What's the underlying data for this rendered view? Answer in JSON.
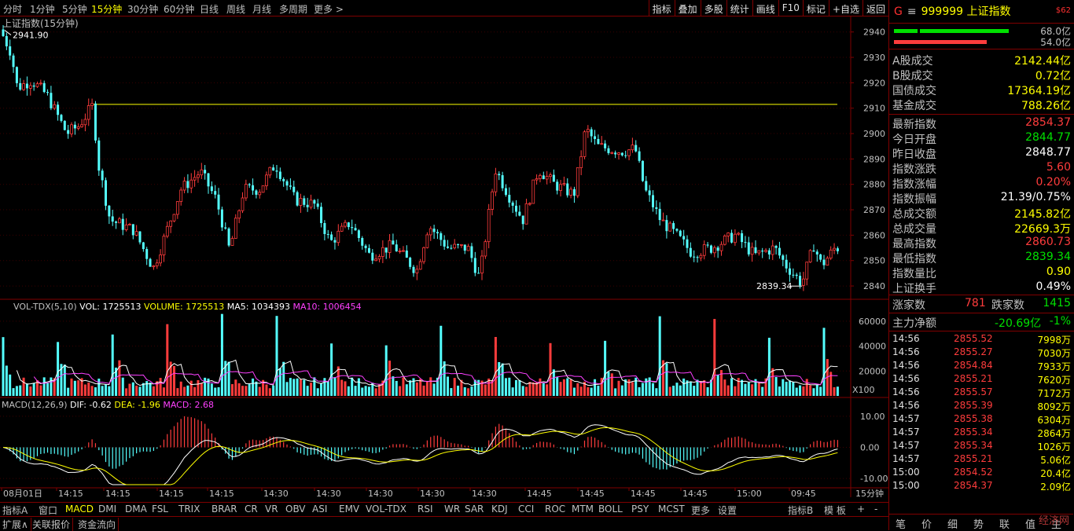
{
  "topbar": {
    "timeframes": [
      "分时",
      "1分钟",
      "5分钟",
      "15分钟",
      "30分钟",
      "60分钟",
      "日线",
      "周线",
      "月线",
      "多周期",
      "更多 >"
    ],
    "active_timeframe": "15分钟",
    "tools": [
      "指标",
      "叠加",
      "多股",
      "统计",
      "画线",
      "F10",
      "标记",
      "+自选",
      "返回"
    ]
  },
  "chart": {
    "title": "上证指数(15分钟)",
    "price_axis_ticks": [
      "2940",
      "2930",
      "2920",
      "2910",
      "2900",
      "2890",
      "2880",
      "2870",
      "2860",
      "2850",
      "2840"
    ],
    "max_label": "2941.90",
    "min_label": "2839.34",
    "vol_legend": {
      "name": "VOL-TDX(5,10)",
      "vol": "VOL: 1725513",
      "volume": "VOLUME: 1725513",
      "ma5": "MA5: 1034393",
      "ma10": "MA10: 1006454"
    },
    "vol_axis_ticks": [
      "60000",
      "40000",
      "20000"
    ],
    "vol_unit": "X100",
    "macd_legend": {
      "name": "MACD(12,26,9)",
      "dif": "DIF: -0.62",
      "dea": "DEA: -1.96",
      "macd": "MACD: 2.68"
    },
    "macd_axis_ticks": [
      "10.00",
      "0.00",
      "-10.00"
    ],
    "time_labels": [
      "08月01日",
      "14:15",
      "14:15",
      "14:15",
      "14:15",
      "14:30",
      "14:30",
      "14:30",
      "14:30",
      "14:30",
      "14:45",
      "14:45",
      "14:45",
      "14:45",
      "15:00",
      "09:45"
    ],
    "period_label": "15分钟"
  },
  "chart_data": {
    "type": "candlestick",
    "ylim": [
      2836,
      2943
    ],
    "y_ticks": [
      2840,
      2850,
      2860,
      2870,
      2880,
      2890,
      2900,
      2910,
      2920,
      2930,
      2940
    ],
    "high": 2941.9,
    "low": 2839.34,
    "reference_line": 2911.5,
    "vol_ylim": [
      0,
      70000
    ],
    "macd_ylim": [
      -12,
      14
    ]
  },
  "panel": {
    "code": "999999",
    "name": "上证指数",
    "g_label": "G",
    "eq_label": "≡",
    "badge": "$62",
    "bar1_value": "68.0亿",
    "bar2_value": "54.0亿",
    "turnover": [
      {
        "label": "A股成交",
        "value": "2142.44亿"
      },
      {
        "label": "B股成交",
        "value": "0.72亿"
      },
      {
        "label": "国债成交",
        "value": "17364.19亿"
      },
      {
        "label": "基金成交",
        "value": "788.26亿"
      }
    ],
    "stats": [
      {
        "label": "最新指数",
        "value": "2854.37",
        "color": "red"
      },
      {
        "label": "今日开盘",
        "value": "2844.77",
        "color": "green"
      },
      {
        "label": "昨日收盘",
        "value": "2848.77",
        "color": "white"
      },
      {
        "label": "指数涨跌",
        "value": "5.60",
        "color": "red"
      },
      {
        "label": "指数涨幅",
        "value": "0.20%",
        "color": "red"
      },
      {
        "label": "指数振幅",
        "value": "21.39/0.75%",
        "color": "white"
      },
      {
        "label": "总成交额",
        "value": "2145.82亿",
        "color": "yellow"
      },
      {
        "label": "总成交量",
        "value": "22669.3万",
        "color": "yellow"
      },
      {
        "label": "最高指数",
        "value": "2860.73",
        "color": "red"
      },
      {
        "label": "最低指数",
        "value": "2839.34",
        "color": "green"
      },
      {
        "label": "指数量比",
        "value": "0.90",
        "color": "yellow"
      },
      {
        "label": "上证换手",
        "value": "0.49%",
        "color": "white"
      }
    ],
    "up_label": "涨家数",
    "up_value": "781",
    "down_label": "跌家数",
    "down_value": "1415",
    "main_flow_label": "主力净额",
    "main_flow_value": "-20.69亿",
    "main_flow_pct": "-1%",
    "ticks": [
      {
        "time": "14:56",
        "price": "2855.52",
        "vol": "7998万"
      },
      {
        "time": "14:56",
        "price": "2855.27",
        "vol": "7030万"
      },
      {
        "time": "14:56",
        "price": "2854.84",
        "vol": "7933万"
      },
      {
        "time": "14:56",
        "price": "2855.21",
        "vol": "7620万"
      },
      {
        "time": "14:56",
        "price": "2855.57",
        "vol": "7172万"
      },
      {
        "time": "14:56",
        "price": "2855.39",
        "vol": "8092万"
      },
      {
        "time": "14:57",
        "price": "2855.38",
        "vol": "6304万"
      },
      {
        "time": "14:57",
        "price": "2855.34",
        "vol": "2864万"
      },
      {
        "time": "14:57",
        "price": "2855.34",
        "vol": "1026万"
      },
      {
        "time": "14:57",
        "price": "2855.21",
        "vol": "5.06亿"
      },
      {
        "time": "15:00",
        "price": "2854.52",
        "vol": "20.4亿"
      },
      {
        "time": "15:00",
        "price": "2854.37",
        "vol": "2.09亿"
      }
    ],
    "footer_tabs": [
      "笔",
      "价",
      "细",
      "势",
      "联",
      "值",
      "主"
    ],
    "watermark": "经济网"
  },
  "bottom": {
    "indicator_tabs": [
      "指标A",
      "窗口",
      "MACD",
      "DMI",
      "DMA",
      "FSL",
      "TRIX",
      "BRAR",
      "CR",
      "VR",
      "OBV",
      "ASI",
      "EMV",
      "VOL-TDX",
      "RSI",
      "WR",
      "SAR",
      "KDJ",
      "CCI",
      "ROC",
      "MTM",
      "BOLL",
      "PSY",
      "MCST",
      "更多",
      "设置"
    ],
    "active_tab": "MACD",
    "right_tabs": [
      "指标B",
      "模 板",
      "+",
      "-"
    ],
    "footer_items": [
      "扩展∧",
      "关联报价",
      "资金流向"
    ]
  },
  "colors": {
    "up": "#ff3c3c",
    "down": "#54ffff",
    "axis": "#800000",
    "yellow": "#ffff00",
    "magenta": "#ff40ff",
    "white": "#ffffff"
  }
}
